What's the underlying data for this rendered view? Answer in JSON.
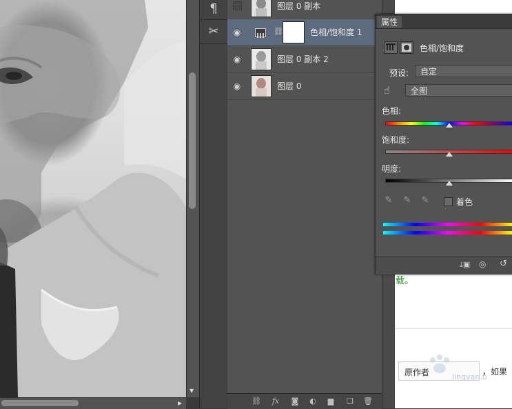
{
  "layers": {
    "rows": [
      {
        "name": "图层 0 副本",
        "visible": false,
        "selected": false
      },
      {
        "name": "色相/饱和度 1",
        "visible": true,
        "selected": true
      },
      {
        "name": "图层 0 副本 2",
        "visible": true,
        "selected": false
      },
      {
        "name": "图层 0",
        "visible": true,
        "selected": false
      }
    ]
  },
  "properties": {
    "tab_label": "属性",
    "adjustment_title": "色相/饱和度",
    "preset_label": "预设:",
    "preset_value": "自定",
    "channel_value": "全图",
    "hue_label": "色相:",
    "saturation_label": "饱和度:",
    "lightness_label": "明度:",
    "colorize_label": "着色",
    "hue_value": 0,
    "saturation_value": 0,
    "lightness_value": 0
  },
  "webpage": {
    "green_text": "载。",
    "ref_text": "原作者",
    "tail_text": "，如果"
  },
  "colors": {
    "selected_row": "#5d6b7e",
    "panel_bg": "#535353",
    "web_green": "#2a8a2a"
  }
}
